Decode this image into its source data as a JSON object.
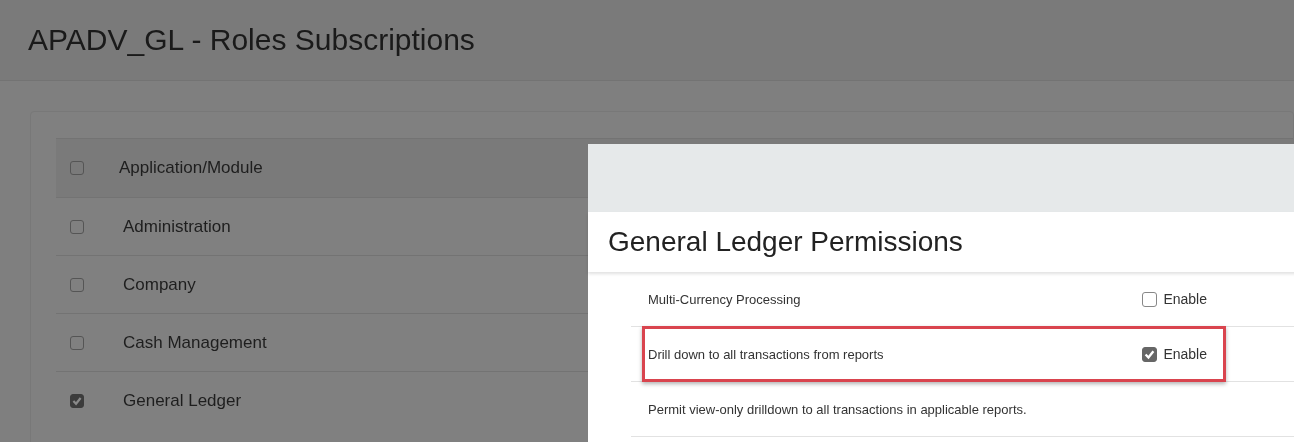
{
  "page": {
    "title": "APADV_GL - Roles Subscriptions"
  },
  "modules": {
    "header": {
      "label": "Application/Module",
      "checked": false
    },
    "rows": [
      {
        "label": "Administration",
        "checked": false
      },
      {
        "label": "Company",
        "checked": false
      },
      {
        "label": "Cash Management",
        "checked": false
      },
      {
        "label": "General Ledger",
        "checked": true
      }
    ]
  },
  "dialog": {
    "title": "General Ledger Permissions",
    "rows": [
      {
        "kind": "permission",
        "label": "Multi-Currency Processing",
        "option": "Enable",
        "checked": false,
        "highlighted": false
      },
      {
        "kind": "permission",
        "label": "Drill down to all transactions from reports",
        "option": "Enable",
        "checked": true,
        "highlighted": true
      },
      {
        "kind": "description",
        "label": "Permit view-only drilldown to all transactions in applicable reports."
      }
    ]
  }
}
